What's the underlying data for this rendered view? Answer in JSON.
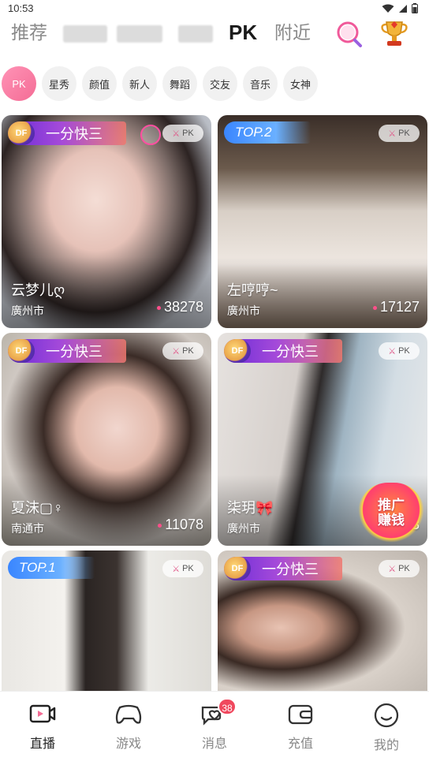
{
  "status_bar": {
    "time": "10:53"
  },
  "top_tabs": [
    {
      "label": "推荐",
      "state": "normal"
    },
    {
      "label": "",
      "state": "blurred"
    },
    {
      "label": "",
      "state": "blurred"
    },
    {
      "label": "",
      "state": "blurred"
    },
    {
      "label": "PK",
      "state": "active"
    },
    {
      "label": "附近",
      "state": "normal"
    }
  ],
  "icons": {
    "search": "search-icon",
    "trophy": "trophy-icon"
  },
  "chips": [
    "PK",
    "星秀",
    "颜值",
    "新人",
    "舞蹈",
    "交友",
    "音乐",
    "女神"
  ],
  "cards": [
    {
      "banner": "一分快三",
      "tag": "",
      "pk": "PK",
      "name": "云梦儿ღ",
      "city": "廣州市",
      "count": "38278"
    },
    {
      "banner": "",
      "tag": "TOP.2",
      "pk": "PK",
      "name": "左哼哼~",
      "city": "廣州市",
      "count": "17127"
    },
    {
      "banner": "一分快三",
      "tag": "",
      "pk": "PK",
      "name": "夏沫▢♀",
      "city": "南通市",
      "count": "11078"
    },
    {
      "banner": "一分快三",
      "tag": "",
      "pk": "PK",
      "name": "柒玥🎀",
      "city": "廣州市",
      "count": "3"
    },
    {
      "banner": "",
      "tag": "TOP.1",
      "pk": "PK",
      "name": "",
      "city": "",
      "count": ""
    },
    {
      "banner": "一分快三",
      "tag": "",
      "pk": "PK",
      "name": "",
      "city": "",
      "count": ""
    }
  ],
  "promo": {
    "line1": "推广",
    "line2": "赚钱"
  },
  "bottom_nav": [
    {
      "label": "直播",
      "icon": "live-icon",
      "active": true
    },
    {
      "label": "游戏",
      "icon": "gamepad-icon",
      "active": false
    },
    {
      "label": "消息",
      "icon": "message-icon",
      "active": false,
      "badge": "38"
    },
    {
      "label": "充值",
      "icon": "wallet-icon",
      "active": false
    },
    {
      "label": "我的",
      "icon": "profile-icon",
      "active": false
    }
  ],
  "colors": {
    "accent_pink": "#f46c95",
    "badge_red": "#f0485e",
    "banner_purple": "#6a2cd8"
  }
}
